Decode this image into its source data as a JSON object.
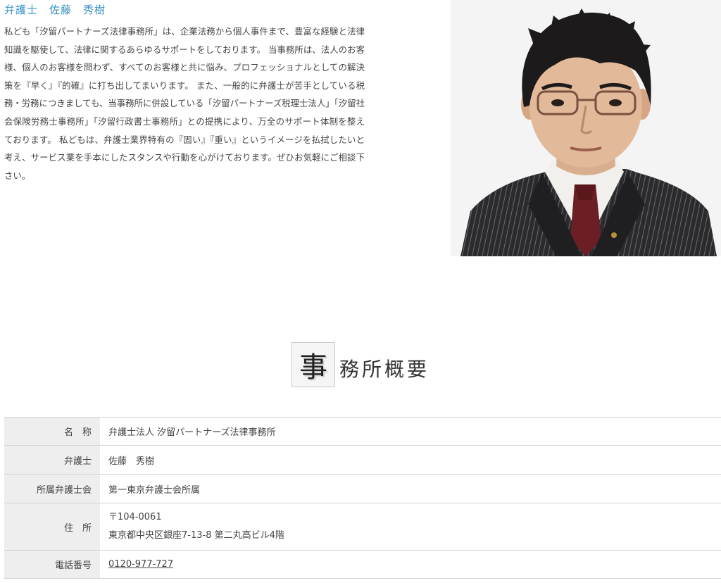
{
  "profile": {
    "name": "弁護士　佐藤　秀樹",
    "intro": "私ども「汐留パートナーズ法律事務所」は、企業法務から個人事件まで、豊富な経験と法律知識を駆使して、法律に関するあらゆるサポートをしております。 当事務所は、法人のお客様、個人のお客様を問わず、すべてのお客様と共に悩み、プロフェッショナルとしての解決策を『早く』『的確』に打ち出してまいります。 また、一般的に弁護士が苦手としている税務・労務につきましても、当事務所に併設している「汐留パートナーズ税理士法人」「汐留社会保険労務士事務所」「汐留行政書士事務所」との提携により、万全のサポート体制を整えております。 私どもは、弁護士業界特有の『固い』『重い』というイメージを払拭したいと考え、サービス業を手本にしたスタンスや行動を心がけております。ぜひお気軽にご相談下さい。"
  },
  "section": {
    "heading_first": "事",
    "heading_rest": "務所概要"
  },
  "overview": {
    "name_label": "名　称",
    "name_value": "弁護士法人 汐留パートナーズ法律事務所",
    "lawyer_label": "弁護士",
    "lawyer_value": "佐藤　秀樹",
    "bar_label": "所属弁護士会",
    "bar_value": "第一東京弁護士会所属",
    "address_label": "住　所",
    "address_postal": "〒104-0061",
    "address_line": "東京都中央区銀座7-13-8 第二丸高ビル4階",
    "phone_label": "電話番号",
    "phone_value": "0120-977-727"
  },
  "colors": {
    "accent": "#3a93c4",
    "header_cell_bg": "#eeeeee"
  }
}
